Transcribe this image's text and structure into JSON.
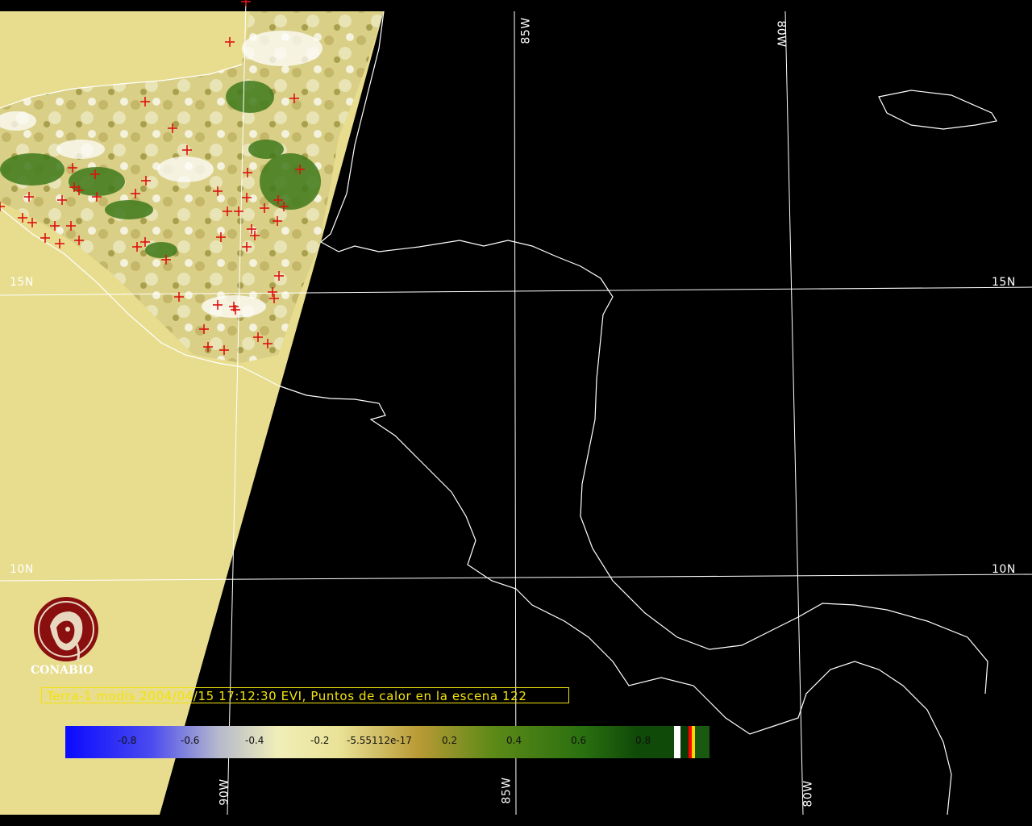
{
  "caption": "Terra-1 modis 2004/04/15 17:12:30 EVI, Puntos de calor en la escena 122",
  "logo": {
    "name": "CONABIO"
  },
  "grid_labels": {
    "lat_15_left": "15N",
    "lat_15_right": "15N",
    "lat_10_left": "10N",
    "lat_10_right": "10N",
    "lon_85_top": "85W",
    "lon_80_top": "80W",
    "lon_90_bottom": "90W",
    "lon_85_bottom": "85W",
    "lon_80_bottom": "80W"
  },
  "colorbar": {
    "ticks": [
      "-0.8",
      "-0.6",
      "-0.4",
      "-0.2",
      "-5.55112e-17",
      "0.2",
      "0.4",
      "0.6",
      "0.8"
    ],
    "colors": {
      "low": "#1010ff",
      "mid_low": "#b8bcc8",
      "mid": "#f5f0a0",
      "mid_high": "#b89a30",
      "high": "#1a6e10"
    },
    "special_colors": [
      "#ffffff",
      "#000000",
      "#ff0000",
      "#ffd700"
    ]
  },
  "colors": {
    "background": "#000000",
    "no_data": "#e8dd8e",
    "coastline": "#ffffff",
    "hotspot": "#dd1111",
    "caption": "#f2e20d"
  }
}
